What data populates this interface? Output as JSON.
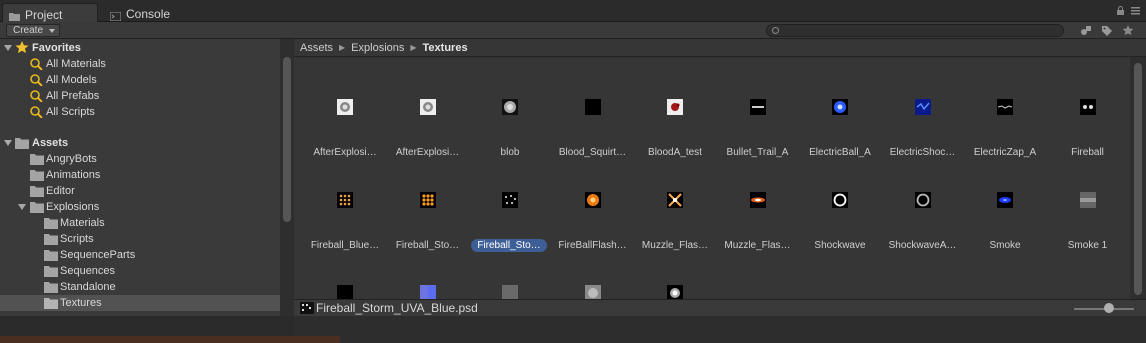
{
  "tabs": [
    {
      "label": "Project",
      "icon": "folder-icon",
      "active": true
    },
    {
      "label": "Console",
      "icon": "console-icon",
      "active": false
    }
  ],
  "toolbar": {
    "create_label": "Create",
    "search_placeholder": ""
  },
  "favorites": {
    "header": "Favorites",
    "items": [
      "All Materials",
      "All Models",
      "All Prefabs",
      "All Scripts"
    ]
  },
  "assets": {
    "header": "Assets",
    "folders": [
      {
        "label": "AngryBots",
        "depth": 1
      },
      {
        "label": "Animations",
        "depth": 1
      },
      {
        "label": "Editor",
        "depth": 1
      },
      {
        "label": "Explosions",
        "depth": 1,
        "expanded": true
      },
      {
        "label": "Materials",
        "depth": 2
      },
      {
        "label": "Scripts",
        "depth": 2
      },
      {
        "label": "SequenceParts",
        "depth": 2
      },
      {
        "label": "Sequences",
        "depth": 2
      },
      {
        "label": "Standalone",
        "depth": 2
      },
      {
        "label": "Textures",
        "depth": 2,
        "selected": true
      }
    ]
  },
  "breadcrumb": [
    "Assets",
    "Explosions",
    "Textures"
  ],
  "grid": {
    "items": [
      {
        "name": "AfterExplosi…",
        "thumb": "swirl-grey"
      },
      {
        "name": "AfterExplosi…",
        "thumb": "swirl-grey"
      },
      {
        "name": "blob",
        "thumb": "blob"
      },
      {
        "name": "Blood_Squirt…",
        "thumb": "black"
      },
      {
        "name": "BloodA_test",
        "thumb": "blood"
      },
      {
        "name": "Bullet_Trail_A",
        "thumb": "trail"
      },
      {
        "name": "ElectricBall_A",
        "thumb": "electric-blue"
      },
      {
        "name": "ElectricShoc…",
        "thumb": "electric-dark-blue"
      },
      {
        "name": "ElectricZap_A",
        "thumb": "zap"
      },
      {
        "name": "Fireball",
        "thumb": "fireball-dots"
      },
      {
        "name": "Fireball_Blue…",
        "thumb": "orange-dots"
      },
      {
        "name": "Fireball_Sto…",
        "thumb": "orange-dots-bright"
      },
      {
        "name": "Fireball_Sto…",
        "thumb": "white-dots",
        "selected": true
      },
      {
        "name": "FireBallFlash…",
        "thumb": "flash-orange"
      },
      {
        "name": "Muzzle_Flas…",
        "thumb": "muzzle-star"
      },
      {
        "name": "Muzzle_Flas…",
        "thumb": "muzzle-streak"
      },
      {
        "name": "Shockwave",
        "thumb": "ring"
      },
      {
        "name": "ShockwaveA…",
        "thumb": "ring-grey"
      },
      {
        "name": "Smoke",
        "thumb": "smoke-blue"
      },
      {
        "name": "Smoke 1",
        "thumb": "smoke-grey"
      },
      {
        "name": "",
        "thumb": "black"
      },
      {
        "name": "",
        "thumb": "purple-blue"
      },
      {
        "name": "",
        "thumb": "grey-square"
      },
      {
        "name": "",
        "thumb": "soft-grey"
      },
      {
        "name": "",
        "thumb": "white-glow"
      }
    ]
  },
  "status": {
    "filename": "Fireball_Storm_UVA_Blue.psd"
  },
  "colors": {
    "selection": "#3e5f96",
    "panel": "#363636",
    "tree": "#3a3a3a"
  }
}
